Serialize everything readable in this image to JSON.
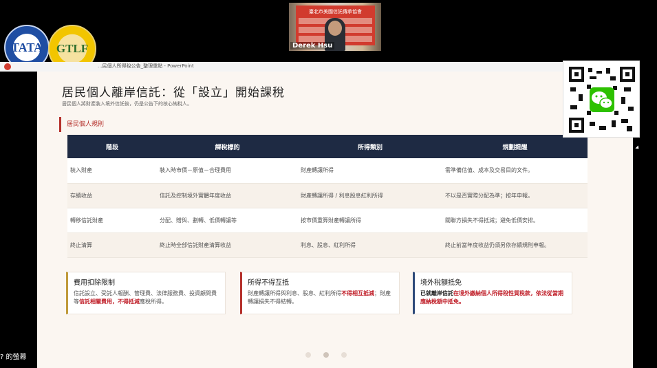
{
  "logos": {
    "tata": "TATA",
    "gtlf": "GTLF"
  },
  "video": {
    "speaker_name": "Derek Hsu",
    "banner_text": "臺北市美國信託傳承協會"
  },
  "ppt": {
    "window_title": "...民個人所得稅公告_整理重點 - PowerPoint"
  },
  "slide": {
    "title": "居民個人離岸信託：從「設立」開始課稅",
    "subtitle": "居民個人將財產裝入境外信託後，仍是公告下的核心納稅人。",
    "section_label": "居民個人規則",
    "table": {
      "headers": [
        "階段",
        "課稅標的",
        "所得類別",
        "規劃提醒"
      ],
      "rows": [
        [
          "裝入財產",
          "裝入時市價－原值－合理費用",
          "財產轉讓所得",
          "需準備估值、成本及交易目的文件。"
        ],
        [
          "存續收益",
          "信託及控制境外實體年度收益",
          "財產轉讓所得 / 利息股息紅利所得",
          "不以是否實際分配為準；按年申報。"
        ],
        [
          "轉移信託財產",
          "分配、贈與、劃轉、低價轉讓等",
          "按市價重算財產轉讓所得",
          "關聯方損失不得抵減；避免低價安排。"
        ],
        [
          "終止清算",
          "終止時全部信託財產清算收益",
          "利息、股息、紅利所得",
          "終止前當年度收益仍須另依存續規則申報。"
        ]
      ]
    },
    "cards": [
      {
        "title": "費用扣除限制",
        "body_pre": "信託設立、受託人報酬、管理費、法律服務費、投資顧問費等",
        "body_em": "信託相關費用，不得抵減",
        "body_post": "應稅所得。"
      },
      {
        "title": "所得不得互抵",
        "body_pre": "財產轉讓所得與利息、股息、紅利所得",
        "body_em": "不得相互抵減",
        "body_post": "；財產轉讓損失不得結轉。"
      },
      {
        "title": "境外稅額抵免",
        "body_pre": "已就離岸信託",
        "body_em": "在境外繳納個人所得稅性質稅款，依法從當期應納稅額中抵免。",
        "body_post": ""
      }
    ]
  },
  "caption": "? 的螢幕",
  "colors": {
    "table_header": "#1e2a43",
    "accent_red": "#b5312c",
    "accent_gold": "#c09a3a",
    "accent_blue": "#2d4a7a",
    "slide_bg": "#fbf6f1"
  }
}
